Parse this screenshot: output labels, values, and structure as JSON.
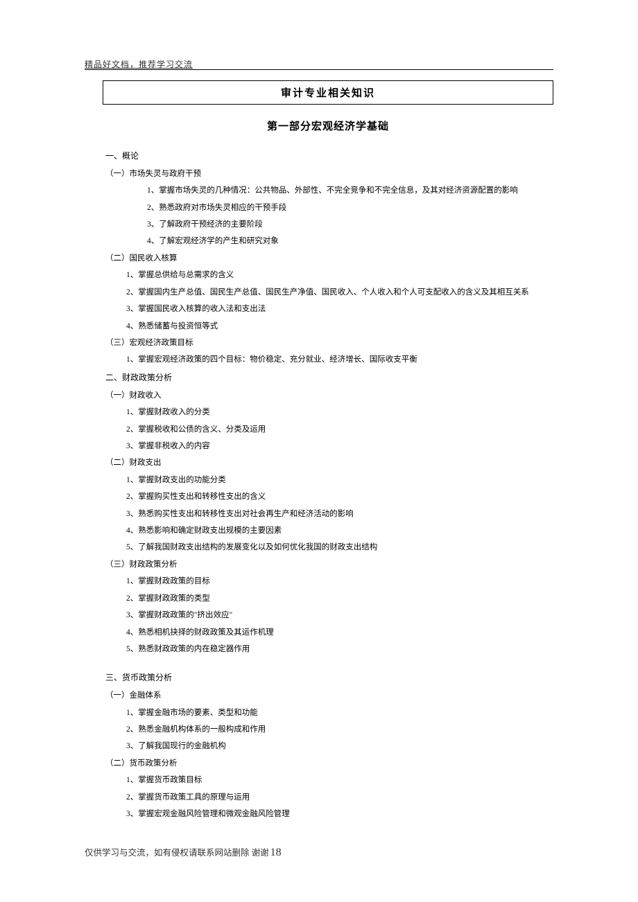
{
  "header_note": "精品好文档，推荐学习交流",
  "doc_title": "审计专业相关知识",
  "part_title": "第一部分宏观经济学基础",
  "sections": {
    "s1": {
      "h": "一、概论"
    },
    "s1a": {
      "h": "（一）市场失灵与政府干预",
      "i1": "1、掌握市场失灵的几种情况：公共物品、外部性、不完全竞争和不完全信息，及其对经济资源配置的影响",
      "i2": "2、熟悉政府对市场失灵相应的干预手段",
      "i3": "3、了解政府干预经济的主要阶段",
      "i4": "4、了解宏观经济学的产生和研究对象"
    },
    "s1b": {
      "h": "（二）国民收入核算",
      "i1": "1、掌握总供给与总需求的含义",
      "i2": "2、掌握国内生产总值、国民生产总值、国民生产净值、国民收入、个人收入和个人可支配收入的含义及其相互关系",
      "i3": "3、掌握国民收入核算的收入法和支出法",
      "i4": "4、熟悉储蓄与投资恒等式"
    },
    "s1c": {
      "h": "（三）宏观经济政策目标",
      "i1": "1、掌握宏观经济政策的四个目标：物价稳定、充分就业、经济增长、国际收支平衡"
    },
    "s2": {
      "h": "二、财政政策分析"
    },
    "s2a": {
      "h": "（一）财政收入",
      "i1": "1、掌握财政收入的分类",
      "i2": "2、掌握税收和公债的含义、分类及运用",
      "i3": "3、掌握非税收入的内容"
    },
    "s2b": {
      "h": "（二）财政支出",
      "i1": "1、掌握财政支出的功能分类",
      "i2": "2、掌握购买性支出和转移性支出的含义",
      "i3": "3、熟悉购买性支出和转移性支出对社会再生产和经济活动的影响",
      "i4": "4、熟悉影响和确定财政支出规模的主要因素",
      "i5": "5、了解我国财政支出结构的发展变化以及如何优化我国的财政支出结构"
    },
    "s2c": {
      "h": "（三）财政政策分析",
      "i1": "1、掌握财政政策的目标",
      "i2": "2、掌握财政政策的类型",
      "i3": "3、掌握财政政策的\"挤出效应\"",
      "i4": "4、熟悉相机抉择的财政政策及其运作机理",
      "i5": "5、熟悉财政政策的内在稳定器作用"
    },
    "s3": {
      "h": "三、货币政策分析"
    },
    "s3a": {
      "h": "（一）金融体系",
      "i1": "1、掌握金融市场的要素、类型和功能",
      "i2": "2、熟悉金融机构体系的一般构成和作用",
      "i3": "3、了解我国现行的金融机构"
    },
    "s3b": {
      "h": "（二）货币政策分析",
      "i1": "1、掌握货币政策目标",
      "i2": "2、掌握货币政策工具的原理与运用",
      "i3": "3、掌握宏观金融风险管理和微观金融风险管理"
    }
  },
  "footer": {
    "text": "仅供学习与交流，如有侵权请联系网站删除 谢谢",
    "page": "18"
  }
}
